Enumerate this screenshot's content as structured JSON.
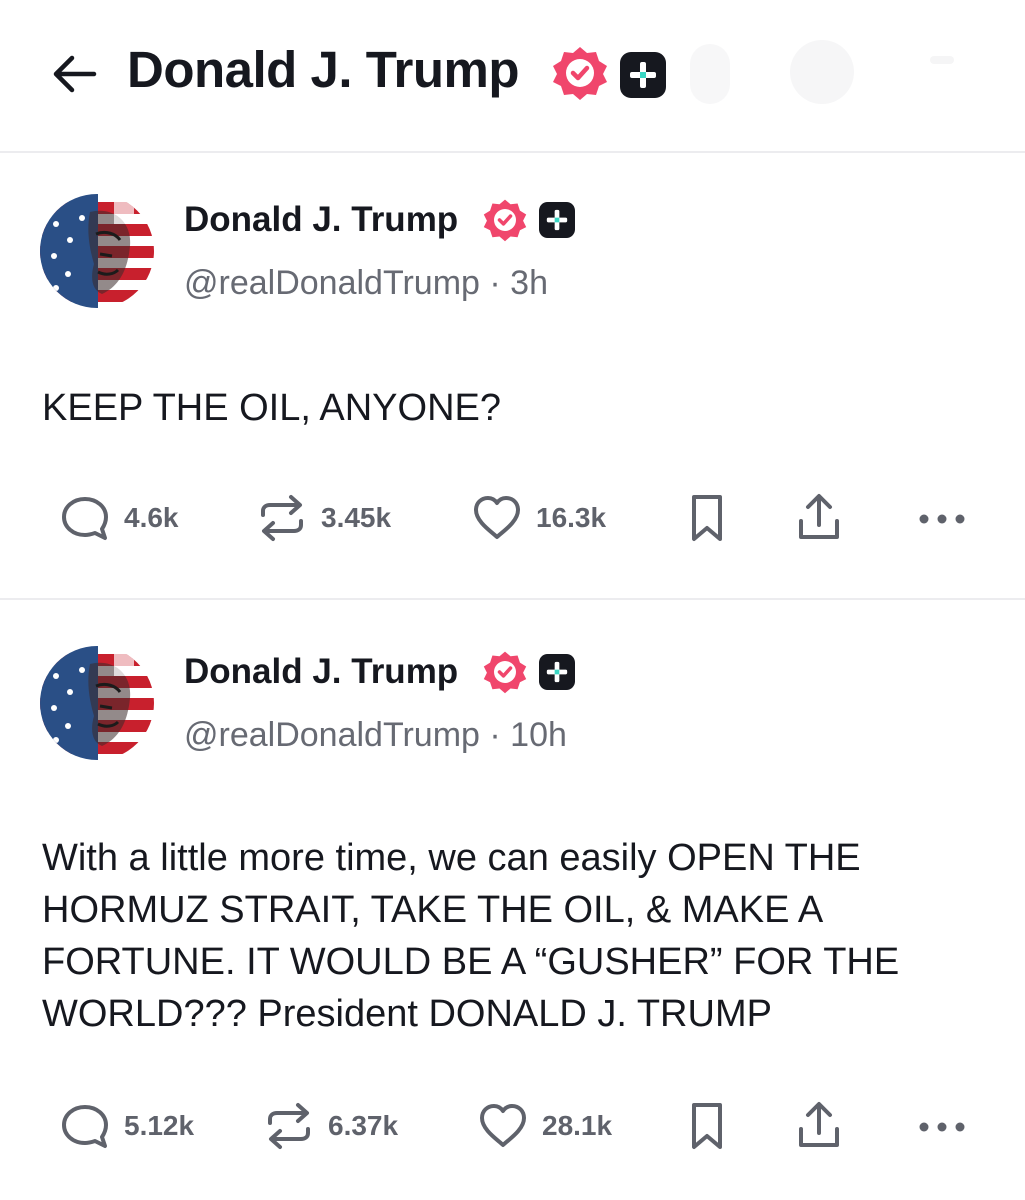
{
  "header": {
    "title": "Donald J. Trump"
  },
  "posts": [
    {
      "author": "Donald J. Trump",
      "handle": "@realDonaldTrump",
      "separator": "·",
      "time": "3h",
      "text": "KEEP THE OIL, ANYONE?",
      "stats": {
        "replies": "4.6k",
        "reposts": "3.45k",
        "likes": "16.3k"
      }
    },
    {
      "author": "Donald J. Trump",
      "handle": "@realDonaldTrump",
      "separator": "·",
      "time": "10h",
      "text": "With a little more time, we can easily OPEN THE HORMUZ STRAIT, TAKE THE OIL, & MAKE A FORTUNE. IT WOULD BE A “GUSHER” FOR THE WORLD??? President DONALD J. TRUMP",
      "stats": {
        "replies": "5.12k",
        "reposts": "6.37k",
        "likes": "28.1k"
      }
    }
  ],
  "colors": {
    "verified": "#f0466c",
    "text": "#16181f",
    "muted": "#676a73",
    "divider": "#ececef"
  },
  "icons": [
    "back-arrow-icon",
    "verified-badge-icon",
    "plus-badge-icon",
    "reply-icon",
    "repost-icon",
    "like-icon",
    "bookmark-icon",
    "share-icon",
    "more-icon"
  ]
}
